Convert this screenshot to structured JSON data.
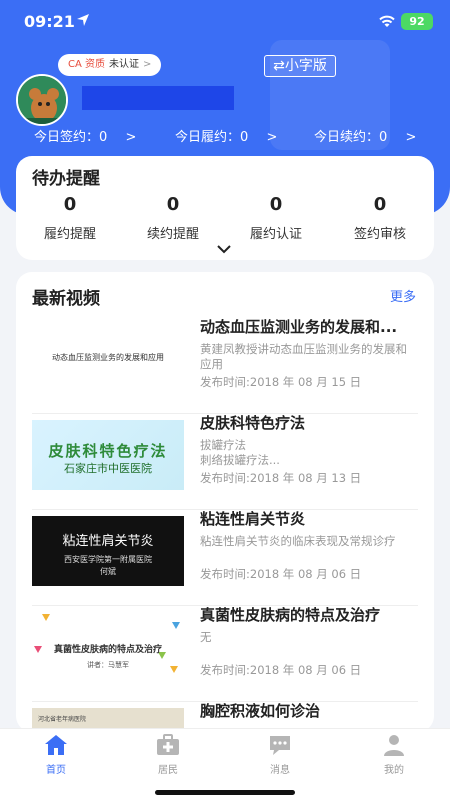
{
  "status_bar": {
    "time": "09:21",
    "battery": "92"
  },
  "header": {
    "ca_label": "CA 资质",
    "ca_status": "未认证",
    "ca_arrow": ">",
    "font_toggle": "⇄小字版",
    "stats": [
      {
        "label": "今日签约：",
        "value": "0"
      },
      {
        "label": "今日履约：",
        "value": "0"
      },
      {
        "label": "今日续约：",
        "value": "0"
      }
    ],
    "stat_arrow": ">"
  },
  "todo": {
    "title": "待办提醒",
    "items": [
      {
        "count": "0",
        "label": "履约提醒"
      },
      {
        "count": "0",
        "label": "续约提醒"
      },
      {
        "count": "0",
        "label": "履约认证"
      },
      {
        "count": "0",
        "label": "签约审核"
      }
    ]
  },
  "videos": {
    "title": "最新视频",
    "more": "更多",
    "items": [
      {
        "title": "动态血压监测业务的发展和...",
        "desc": "黄建凤教授讲动态血压监测业务的发展和应用",
        "date": "发布时间:2018 年 08 月 15 日",
        "thumb_text": "动态血压监测业务的发展和应用"
      },
      {
        "title": "皮肤科特色疗法",
        "desc": "拔罐疗法\n刺络拔罐疗法...",
        "date": "发布时间:2018 年 08 月 13 日",
        "thumb_text": "皮肤科特色疗法",
        "thumb_sub": "石家庄市中医医院"
      },
      {
        "title": "粘连性肩关节炎",
        "desc": "粘连性肩关节炎的临床表现及常规诊疗",
        "date": "发布时间:2018 年 08 月 06 日",
        "thumb_text": "粘连性肩关节炎",
        "thumb_sub": "西安医学院第一附属医院",
        "thumb_sub2": "何斌"
      },
      {
        "title": "真菌性皮肤病的特点及治疗",
        "desc": "无",
        "date": "发布时间:2018 年 08 月 06 日",
        "thumb_text": "真菌性皮肤病的特点及治疗",
        "thumb_sub": "讲者：马慧军"
      },
      {
        "title": "胸腔积液如何诊治",
        "desc": "",
        "date": "",
        "thumb_text": "河北省老年病医院"
      }
    ]
  },
  "tabs": [
    {
      "label": "首页",
      "icon": "home-icon",
      "active": true
    },
    {
      "label": "居民",
      "icon": "medical-kit-icon",
      "active": false
    },
    {
      "label": "消息",
      "icon": "chat-icon",
      "active": false
    },
    {
      "label": "我的",
      "icon": "user-icon",
      "active": false
    }
  ],
  "colors": {
    "primary": "#3b6ef5",
    "battery": "#4cd964",
    "ca_red": "#e74c3c"
  }
}
